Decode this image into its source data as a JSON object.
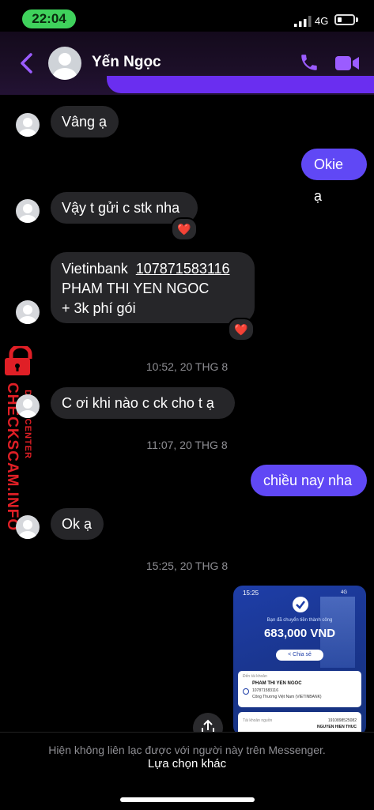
{
  "status_bar": {
    "time": "22:04",
    "network": "4G"
  },
  "header": {
    "contact_name": "Yến Ngọc"
  },
  "messages": [
    {
      "text": "Vâng ạ"
    },
    {
      "text": "Okie ạ"
    },
    {
      "text": "Vậy t gửi c stk nha",
      "reaction": "❤️"
    },
    {
      "line1_bank": "Vietinbank",
      "line1_account": "107871583116",
      "line2": "PHAM THI YEN NGOC",
      "line3": "+ 3k phí gói",
      "reaction": "❤️"
    },
    {
      "timestamp": "10:52, 20 THG 8"
    },
    {
      "text": "C ơi khi nào c ck cho t ạ"
    },
    {
      "timestamp": "11:07, 20 THG 8"
    },
    {
      "text": "chiều nay nha"
    },
    {
      "text": "Ok ạ"
    },
    {
      "timestamp": "15:25, 20 THG 8"
    }
  ],
  "receipt": {
    "time": "15:25",
    "network": "4G",
    "headline": "Bạn đã chuyển tiền thành công",
    "amount": "683,000 VND",
    "share_label": "Chia sẻ",
    "to_label": "Đến tài khoản",
    "to_name": "PHAM THI YEN NGOC",
    "to_account": "107871583116",
    "to_bank": "Công Thương Việt Nam (VIETINBANK)",
    "from_label": "Tài khoản nguồn",
    "from_account": "1910898525082",
    "from_name": "NGUYEN HIEN THUC"
  },
  "watermark": {
    "line1": "DATA CENTER",
    "line2": "CHECKSCAM.INFO"
  },
  "footer": {
    "notice": "Hiện không liên lạc được với người này trên Messenger.",
    "action": "Lựa chọn khác"
  },
  "colors": {
    "accent": "#6048f5",
    "header_icon": "#9b5cff",
    "watermark": "#e01f26"
  }
}
